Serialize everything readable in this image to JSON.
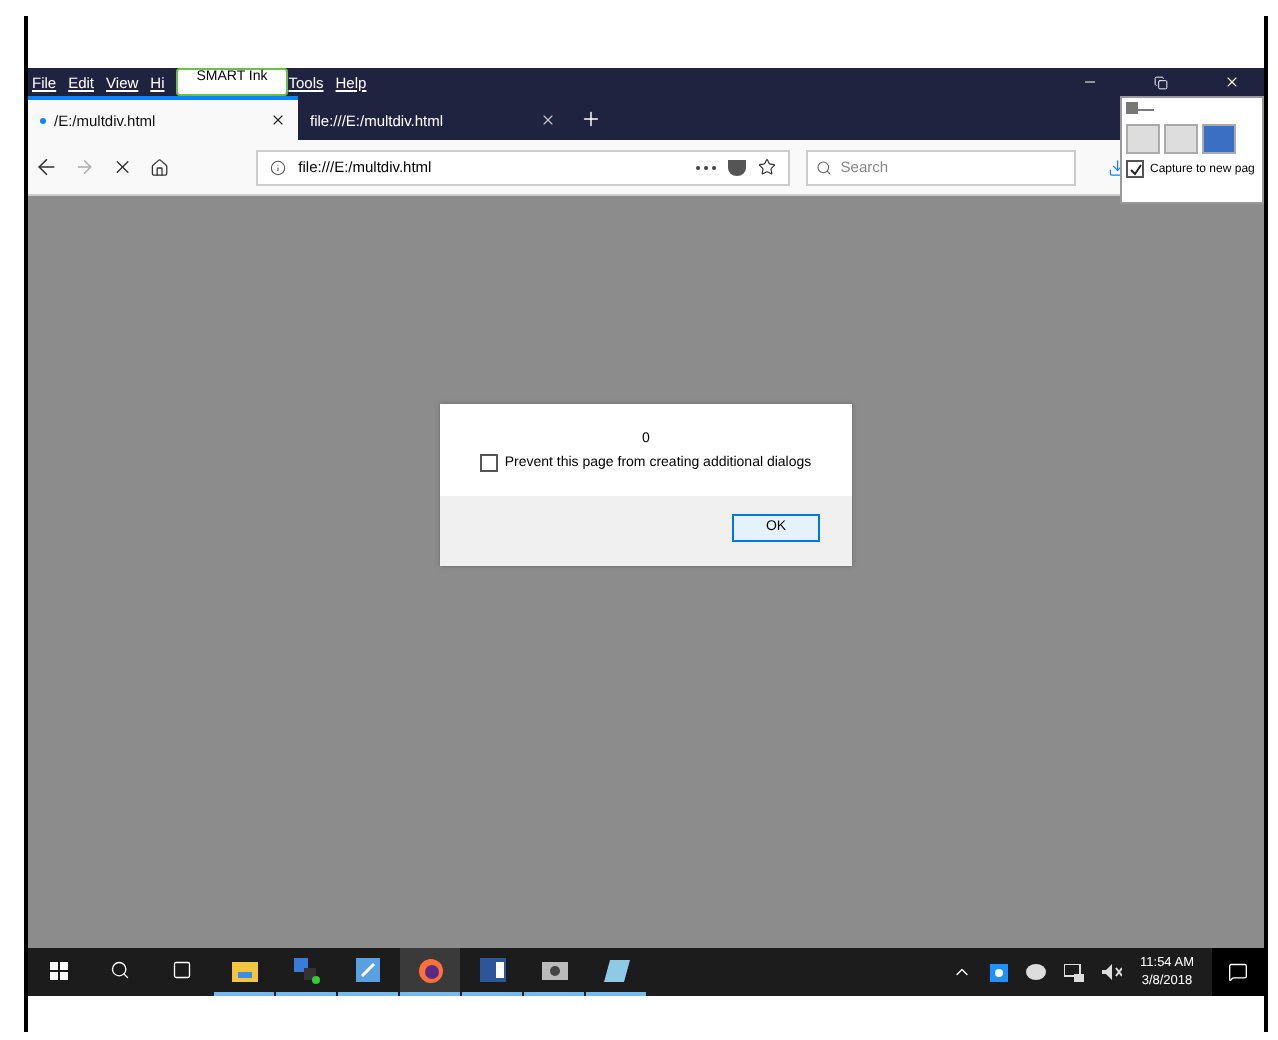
{
  "menu_bar": {
    "items": [
      "File",
      "Edit",
      "View",
      "Hi",
      "Tools",
      "Help"
    ],
    "smart_ink": {
      "label": "SMART Ink"
    }
  },
  "tabs": [
    {
      "label": "/E:/multdiv.html",
      "selected": true
    },
    {
      "label": "file:///E:/multdiv.html",
      "selected": false
    }
  ],
  "address_bar": {
    "url": "file:///E:/multdiv.html"
  },
  "search": {
    "placeholder": "Search"
  },
  "capture_panel": {
    "checkbox": {
      "label": "Capture to new pag",
      "checked": true
    }
  },
  "dialog": {
    "message": "0",
    "checkbox": {
      "label": "Prevent this page from creating additional dialogs",
      "checked": false
    },
    "button": "OK"
  },
  "taskbar": {
    "apps": [
      {
        "kind": "explorer",
        "running": true,
        "selected": false
      },
      {
        "kind": "network",
        "running": true,
        "selected": false
      },
      {
        "kind": "notes",
        "running": true,
        "selected": false
      },
      {
        "kind": "firefox",
        "running": true,
        "selected": true
      },
      {
        "kind": "word",
        "running": true,
        "selected": false
      },
      {
        "kind": "camera",
        "running": true,
        "selected": false
      },
      {
        "kind": "pen",
        "running": true,
        "selected": false
      }
    ],
    "clock": {
      "time": "11:54 AM",
      "date": "3/8/2018"
    }
  }
}
